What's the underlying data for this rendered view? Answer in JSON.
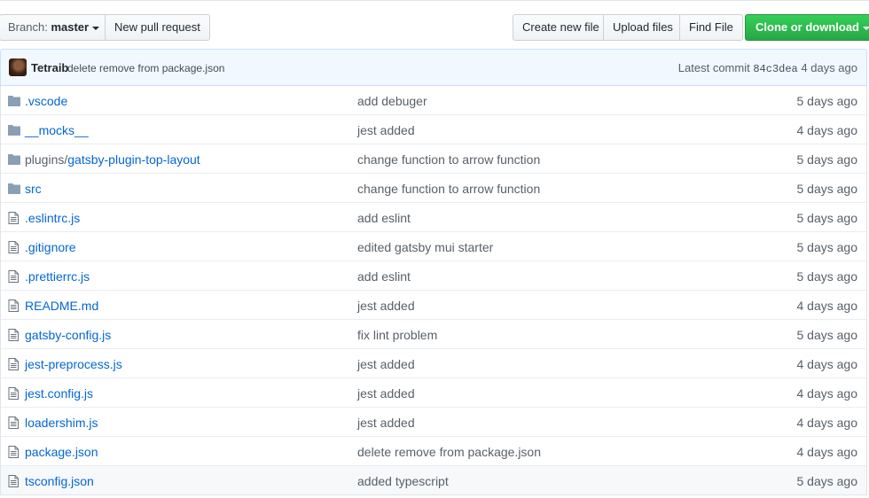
{
  "toolbar": {
    "branch_prefix": "Branch:",
    "branch_name": "master",
    "new_pull_request": "New pull request",
    "create_new_file": "Create new file",
    "upload_files": "Upload files",
    "find_file": "Find File",
    "clone_or_download": "Clone or download"
  },
  "commit": {
    "author": "Tetraib",
    "message": "delete remove from package.json",
    "latest_label": "Latest commit",
    "sha": "84c3dea",
    "age": "4 days ago"
  },
  "files": [
    {
      "type": "dir",
      "prefix": "",
      "name": ".vscode",
      "message": "add debuger",
      "age": "5 days ago"
    },
    {
      "type": "dir",
      "prefix": "",
      "name": "__mocks__",
      "message": "jest added",
      "age": "4 days ago"
    },
    {
      "type": "dir",
      "prefix": "plugins/",
      "name": "gatsby-plugin-top-layout",
      "message": "change function to arrow function",
      "age": "5 days ago"
    },
    {
      "type": "dir",
      "prefix": "",
      "name": "src",
      "message": "change function to arrow function",
      "age": "5 days ago"
    },
    {
      "type": "file",
      "prefix": "",
      "name": ".eslintrc.js",
      "message": "add eslint",
      "age": "5 days ago"
    },
    {
      "type": "file",
      "prefix": "",
      "name": ".gitignore",
      "message": "edited gatsby mui starter",
      "age": "5 days ago"
    },
    {
      "type": "file",
      "prefix": "",
      "name": ".prettierrc.js",
      "message": "add eslint",
      "age": "5 days ago"
    },
    {
      "type": "file",
      "prefix": "",
      "name": "README.md",
      "message": "jest added",
      "age": "4 days ago"
    },
    {
      "type": "file",
      "prefix": "",
      "name": "gatsby-config.js",
      "message": "fix lint problem",
      "age": "5 days ago"
    },
    {
      "type": "file",
      "prefix": "",
      "name": "jest-preprocess.js",
      "message": "jest added",
      "age": "4 days ago"
    },
    {
      "type": "file",
      "prefix": "",
      "name": "jest.config.js",
      "message": "jest added",
      "age": "4 days ago"
    },
    {
      "type": "file",
      "prefix": "",
      "name": "loadershim.js",
      "message": "jest added",
      "age": "4 days ago"
    },
    {
      "type": "file",
      "prefix": "",
      "name": "package.json",
      "message": "delete remove from package.json",
      "age": "4 days ago"
    },
    {
      "type": "file",
      "prefix": "",
      "name": "tsconfig.json",
      "message": "added typescript",
      "age": "5 days ago"
    }
  ],
  "icons": {
    "dir": "folder-icon",
    "file": "file-icon"
  },
  "colors": {
    "link": "#0366d6",
    "clone_button": "#28a745",
    "commit_bar": "#f1f8ff"
  }
}
